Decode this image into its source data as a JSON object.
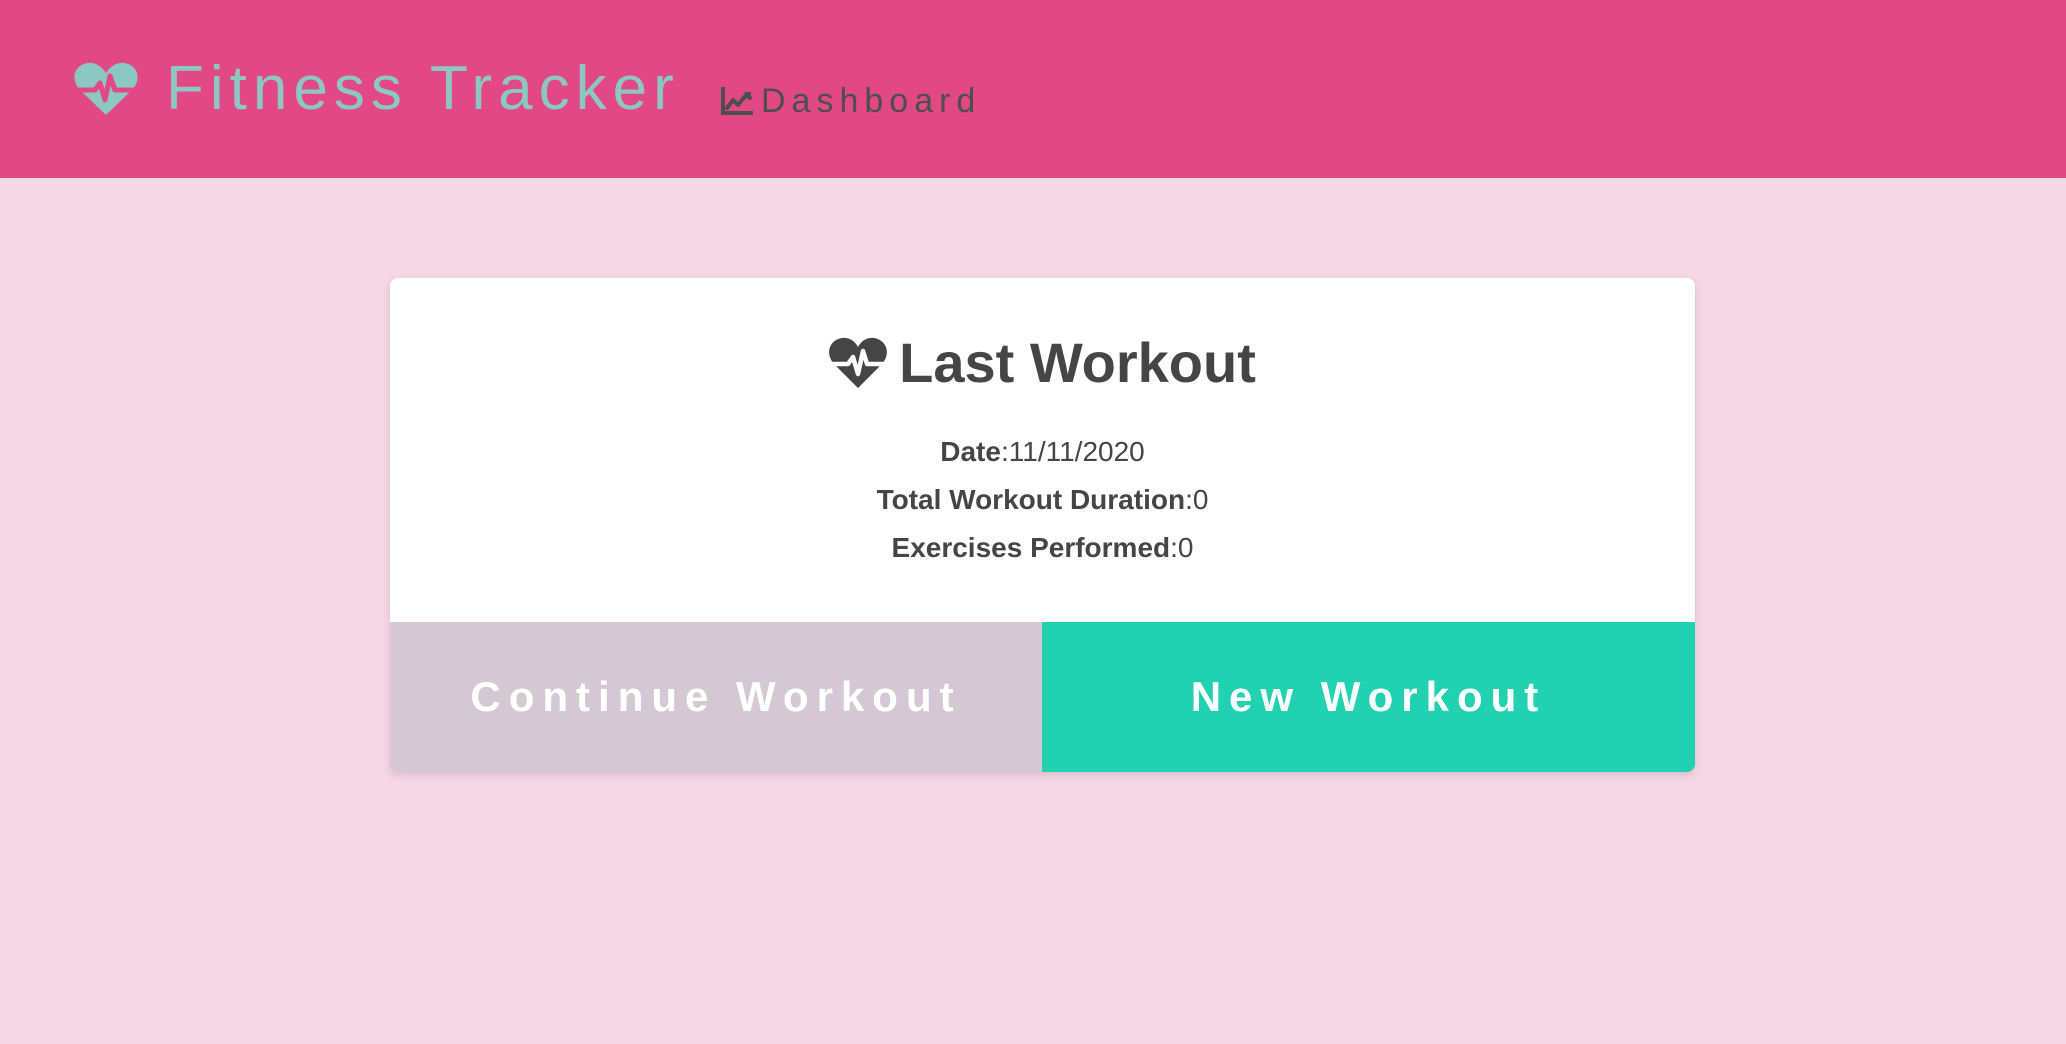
{
  "header": {
    "brand": {
      "icon": "heartbeat-icon",
      "title": "Fitness Tracker"
    },
    "nav": [
      {
        "icon": "chart-line-icon",
        "label": "Dashboard"
      }
    ]
  },
  "card": {
    "icon": "heartbeat-icon",
    "title": "Last Workout",
    "stats": [
      {
        "label": "Date",
        "separator": ": ",
        "value": "11/11/2020"
      },
      {
        "label": "Total Workout Duration",
        "separator": ": ",
        "value": "0"
      },
      {
        "label": "Exercises Performed",
        "separator": ": ",
        "value": "0"
      }
    ],
    "buttons": {
      "continue_label": "Continue Workout",
      "new_label": "New Workout"
    }
  },
  "colors": {
    "header_bg": "#e24984",
    "page_bg": "#f5d7e5",
    "brand_text": "#8cc7c2",
    "card_bg": "#ffffff",
    "continue_bg": "#d4c8d2",
    "new_bg": "#22d1b0",
    "text_dark": "#454545"
  }
}
